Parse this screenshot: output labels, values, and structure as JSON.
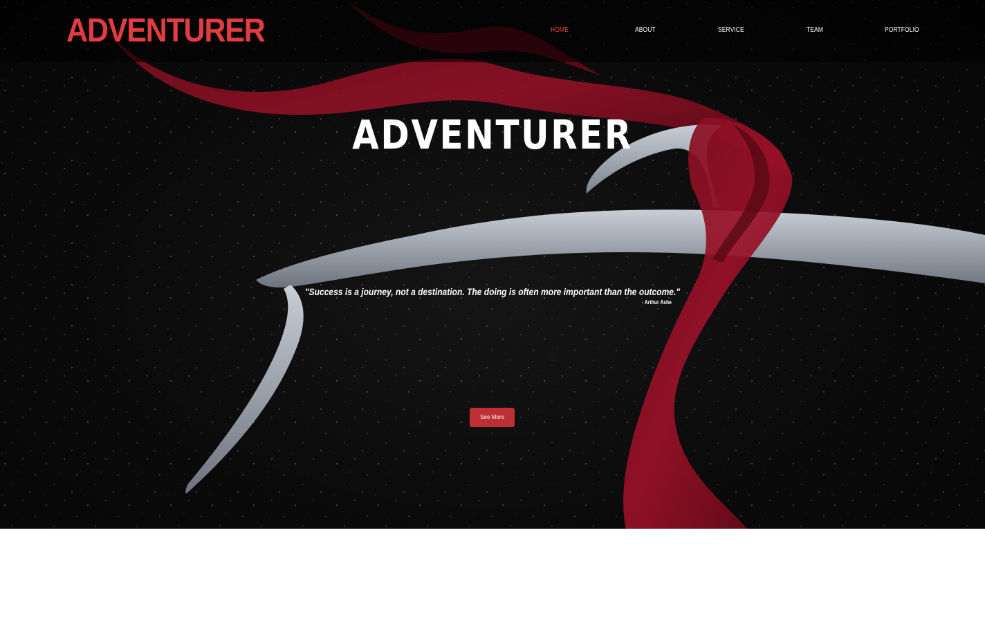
{
  "brand": {
    "logo_text": "ADVENTURER",
    "accent_color": "#e23c40"
  },
  "nav": {
    "items": [
      {
        "label": "HOME",
        "active": true
      },
      {
        "label": "ABOUT",
        "active": false
      },
      {
        "label": "SERVICE",
        "active": false
      },
      {
        "label": "TEAM",
        "active": false
      },
      {
        "label": "PORTFOLIO",
        "active": false
      }
    ]
  },
  "hero": {
    "title": "ADVENTURER",
    "quote": "\"Success is a journey, not a destination. The doing is often more important than the outcome.\"",
    "quote_author": "- Arthur Ashe",
    "cta_label": "See More",
    "cta_color": "#bd2f35",
    "background_image": "dark starry background with a pale deer antler wrapped in red velvet cloth"
  }
}
